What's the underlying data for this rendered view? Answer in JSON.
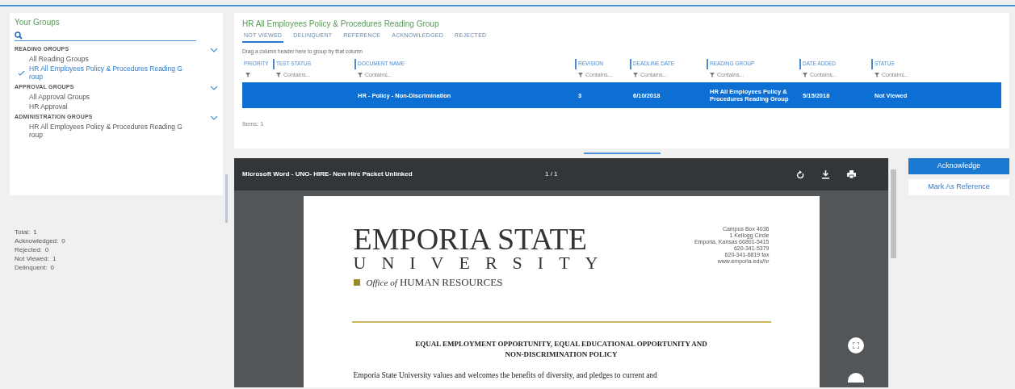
{
  "sidebar": {
    "title": "Your Groups",
    "sections": [
      {
        "label": "READING GROUPS",
        "expanded": true,
        "items": [
          {
            "label": "All Reading Groups",
            "selected": false
          },
          {
            "label": "HR All Employees Policy & Procedures Reading Group",
            "selected": true
          }
        ]
      },
      {
        "label": "APPROVAL GROUPS",
        "expanded": true,
        "items": [
          {
            "label": "All Approval Groups",
            "selected": false
          },
          {
            "label": "HR Approval",
            "selected": false
          }
        ]
      },
      {
        "label": "ADMINISTRATION GROUPS",
        "expanded": true,
        "items": [
          {
            "label": "HR All Employees Policy & Procedures Reading Group",
            "selected": false
          }
        ]
      }
    ]
  },
  "stats": [
    {
      "label": "Total:",
      "value": "1"
    },
    {
      "label": "Acknowledged:",
      "value": "0"
    },
    {
      "label": "Rejected:",
      "value": "0"
    },
    {
      "label": "Not Viewed:",
      "value": "1"
    },
    {
      "label": "Delinquent:",
      "value": "0"
    }
  ],
  "main": {
    "title": "HR All Employees Policy & Procedures Reading Group",
    "tabs": [
      {
        "label": "NOT VIEWED",
        "selected": true
      },
      {
        "label": "DELINQUENT",
        "selected": false
      },
      {
        "label": "REFERENCE",
        "selected": false
      },
      {
        "label": "ACKNOWLEDGED",
        "selected": false
      },
      {
        "label": "REJECTED",
        "selected": false
      }
    ],
    "group_hint": "Drag a column header here to group by that column",
    "table": {
      "columns": [
        {
          "label": "PRIORITY"
        },
        {
          "label": "TEST STATUS",
          "filter": "Contains..."
        },
        {
          "label": "DOCUMENT NAME",
          "filter": "Contains..."
        },
        {
          "label": "REVISION",
          "filter": "Contains..."
        },
        {
          "label": "DEADLINE DATE",
          "filter": "Contains..."
        },
        {
          "label": "READING GROUP",
          "filter": "Contains..."
        },
        {
          "label": "DATE ADDED",
          "filter": "Contains..."
        },
        {
          "label": "STATUS",
          "filter": "Contains..."
        }
      ],
      "rows": [
        {
          "selected": true,
          "cells": [
            "",
            "",
            "HR - Policy - Non-Discrimination",
            "3",
            "6/10/2018",
            "HR All Employees Policy & Procedures Reading Group",
            "5/15/2018",
            "Not Viewed"
          ]
        }
      ]
    },
    "items_count": "Items: 1"
  },
  "viewer": {
    "title": "Microsoft Word - UNO- HIRE- New Hire Packet Unlinked",
    "page_count": "1 / 1",
    "document": {
      "logo_line1": "EMPORIA STATE",
      "logo_line2": "UNIVERSITY",
      "office_prefix": "Office of",
      "office": "HUMAN RESOURCES",
      "address": [
        "Campus Box 4036",
        "1 Kellogg Circle",
        "Emporia, Kansas 66801-5415",
        "620-341-5379",
        "620-341-6819 fax",
        "www.emporia.edu/hr"
      ],
      "heading": "EQUAL EMPLOYMENT OPPORTUNITY, EQUAL EDUCATIONAL OPPORTUNITY AND NON-DISCRIMINATION POLICY",
      "body": "Emporia State University values and welcomes the benefits of diversity, and pledges to current and"
    }
  },
  "actions": [
    {
      "label": "Acknowledge",
      "kind": "primary"
    },
    {
      "label": "Mark As Reference",
      "kind": "secondary"
    }
  ]
}
